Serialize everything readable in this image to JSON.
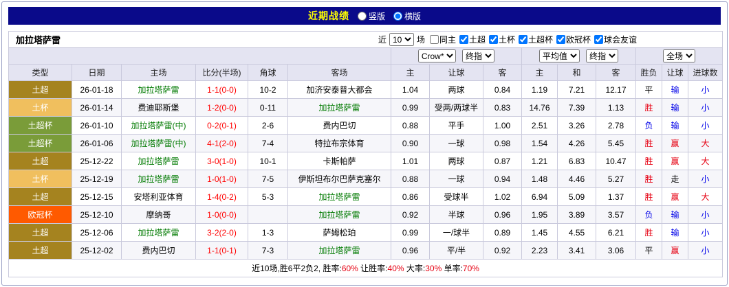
{
  "titlebar": {
    "title": "近期战绩",
    "options": [
      {
        "label": "竖版",
        "selected": false
      },
      {
        "label": "横版",
        "selected": true
      }
    ]
  },
  "filterbar": {
    "team": "加拉塔萨雷",
    "recent_label": "近",
    "recent_value": "10",
    "games_label": "场",
    "checkboxes": [
      {
        "label": "同主",
        "checked": false
      },
      {
        "label": "土超",
        "checked": true
      },
      {
        "label": "土杯",
        "checked": true
      },
      {
        "label": "土超杯",
        "checked": true
      },
      {
        "label": "欧冠杯",
        "checked": true
      },
      {
        "label": "球会友谊",
        "checked": true
      }
    ]
  },
  "selectors": {
    "handicap_source": "Crow*",
    "handicap_time": "终指",
    "europe_avg": "平均值",
    "europe_time": "终指",
    "scope": "全场"
  },
  "columns": [
    "类型",
    "日期",
    "主场",
    "比分(半场)",
    "角球",
    "客场",
    "主",
    "让球",
    "客",
    "主",
    "和",
    "客",
    "胜负",
    "让球",
    "进球数"
  ],
  "palette": {
    "titlebar_bg": "#0a0a8a",
    "title_yellow": "#ffff00",
    "red": "#e60012",
    "score_red": "#ff0000",
    "blue": "#0000e8",
    "green": "#007a00",
    "black": "#000000",
    "header_bg": "#e4e4f2",
    "table_border": "#c9c9dc",
    "table_border_outer": "#a9a9c9",
    "frame_border": "#9aa0c4",
    "row_alt": "#f6f6fa"
  },
  "type_colors": {
    "土超": "#a5831f",
    "土杯": "#f0bf5e",
    "土超杯": "#7a9c39",
    "欧冠杯": "#ff5a00"
  },
  "rows": [
    {
      "type": "土超",
      "date": "26-01-18",
      "home": "加拉塔萨雷",
      "home_color": "green",
      "score": "1-1(0-0)",
      "corner": "10-2",
      "away": "加济安泰普大都会",
      "away_color": "black",
      "ah": [
        "1.04",
        "两球",
        "0.84"
      ],
      "eu": [
        "1.19",
        "7.21",
        "12.17"
      ],
      "result": "平",
      "result_color": "black",
      "ah_result": "输",
      "ah_result_color": "blue",
      "goals": "小",
      "goals_color": "blue"
    },
    {
      "type": "土杯",
      "date": "26-01-14",
      "home": "费迪耶斯堡",
      "home_color": "black",
      "score": "1-2(0-0)",
      "corner": "0-11",
      "away": "加拉塔萨雷",
      "away_color": "green",
      "ah": [
        "0.99",
        "受两/两球半",
        "0.83"
      ],
      "eu": [
        "14.76",
        "7.39",
        "1.13"
      ],
      "result": "胜",
      "result_color": "red",
      "ah_result": "输",
      "ah_result_color": "blue",
      "goals": "小",
      "goals_color": "blue"
    },
    {
      "type": "土超杯",
      "date": "26-01-10",
      "home": "加拉塔萨雷(中)",
      "home_color": "green",
      "score": "0-2(0-1)",
      "corner": "2-6",
      "away": "费内巴切",
      "away_color": "black",
      "ah": [
        "0.88",
        "平手",
        "1.00"
      ],
      "eu": [
        "2.51",
        "3.26",
        "2.78"
      ],
      "result": "负",
      "result_color": "blue",
      "ah_result": "输",
      "ah_result_color": "blue",
      "goals": "小",
      "goals_color": "blue"
    },
    {
      "type": "土超杯",
      "date": "26-01-06",
      "home": "加拉塔萨雷(中)",
      "home_color": "green",
      "score": "4-1(2-0)",
      "corner": "7-4",
      "away": "特拉布宗体育",
      "away_color": "black",
      "ah": [
        "0.90",
        "一球",
        "0.98"
      ],
      "eu": [
        "1.54",
        "4.26",
        "5.45"
      ],
      "result": "胜",
      "result_color": "red",
      "ah_result": "赢",
      "ah_result_color": "red",
      "goals": "大",
      "goals_color": "red"
    },
    {
      "type": "土超",
      "date": "25-12-22",
      "home": "加拉塔萨雷",
      "home_color": "green",
      "score": "3-0(1-0)",
      "corner": "10-1",
      "away": "卡斯帕萨",
      "away_color": "black",
      "ah": [
        "1.01",
        "两球",
        "0.87"
      ],
      "eu": [
        "1.21",
        "6.83",
        "10.47"
      ],
      "result": "胜",
      "result_color": "red",
      "ah_result": "赢",
      "ah_result_color": "red",
      "goals": "大",
      "goals_color": "red"
    },
    {
      "type": "土杯",
      "date": "25-12-19",
      "home": "加拉塔萨雷",
      "home_color": "green",
      "score": "1-0(1-0)",
      "corner": "7-5",
      "away": "伊斯坦布尔巴萨克塞尔",
      "away_color": "black",
      "ah": [
        "0.88",
        "一球",
        "0.94"
      ],
      "eu": [
        "1.48",
        "4.46",
        "5.27"
      ],
      "result": "胜",
      "result_color": "red",
      "ah_result": "走",
      "ah_result_color": "black",
      "goals": "小",
      "goals_color": "blue"
    },
    {
      "type": "土超",
      "date": "25-12-15",
      "home": "安塔利亚体育",
      "home_color": "black",
      "score": "1-4(0-2)",
      "corner": "5-3",
      "away": "加拉塔萨雷",
      "away_color": "green",
      "ah": [
        "0.86",
        "受球半",
        "1.02"
      ],
      "eu": [
        "6.94",
        "5.09",
        "1.37"
      ],
      "result": "胜",
      "result_color": "red",
      "ah_result": "赢",
      "ah_result_color": "red",
      "goals": "大",
      "goals_color": "red"
    },
    {
      "type": "欧冠杯",
      "date": "25-12-10",
      "home": "摩纳哥",
      "home_color": "black",
      "score": "1-0(0-0)",
      "corner": "",
      "away": "加拉塔萨雷",
      "away_color": "green",
      "ah": [
        "0.92",
        "半球",
        "0.96"
      ],
      "eu": [
        "1.95",
        "3.89",
        "3.57"
      ],
      "result": "负",
      "result_color": "blue",
      "ah_result": "输",
      "ah_result_color": "blue",
      "goals": "小",
      "goals_color": "blue"
    },
    {
      "type": "土超",
      "date": "25-12-06",
      "home": "加拉塔萨雷",
      "home_color": "green",
      "score": "3-2(2-0)",
      "corner": "1-3",
      "away": "萨姆松珀",
      "away_color": "black",
      "ah": [
        "0.99",
        "一/球半",
        "0.89"
      ],
      "eu": [
        "1.45",
        "4.55",
        "6.21"
      ],
      "result": "胜",
      "result_color": "red",
      "ah_result": "输",
      "ah_result_color": "blue",
      "goals": "小",
      "goals_color": "blue"
    },
    {
      "type": "土超",
      "date": "25-12-02",
      "home": "费内巴切",
      "home_color": "black",
      "score": "1-1(0-1)",
      "corner": "7-3",
      "away": "加拉塔萨雷",
      "away_color": "green",
      "ah": [
        "0.96",
        "平/半",
        "0.92"
      ],
      "eu": [
        "2.23",
        "3.41",
        "3.06"
      ],
      "result": "平",
      "result_color": "black",
      "ah_result": "赢",
      "ah_result_color": "red",
      "goals": "小",
      "goals_color": "blue"
    }
  ],
  "footer": {
    "segments": [
      {
        "text": "近10场,胜6平2负2, 胜率:",
        "color": "black"
      },
      {
        "text": "60%",
        "color": "red"
      },
      {
        "text": " 让胜率:",
        "color": "black"
      },
      {
        "text": "40%",
        "color": "red"
      },
      {
        "text": " 大率:",
        "color": "black"
      },
      {
        "text": "30%",
        "color": "red"
      },
      {
        "text": " 单率:",
        "color": "black"
      },
      {
        "text": "70%",
        "color": "red"
      }
    ]
  }
}
